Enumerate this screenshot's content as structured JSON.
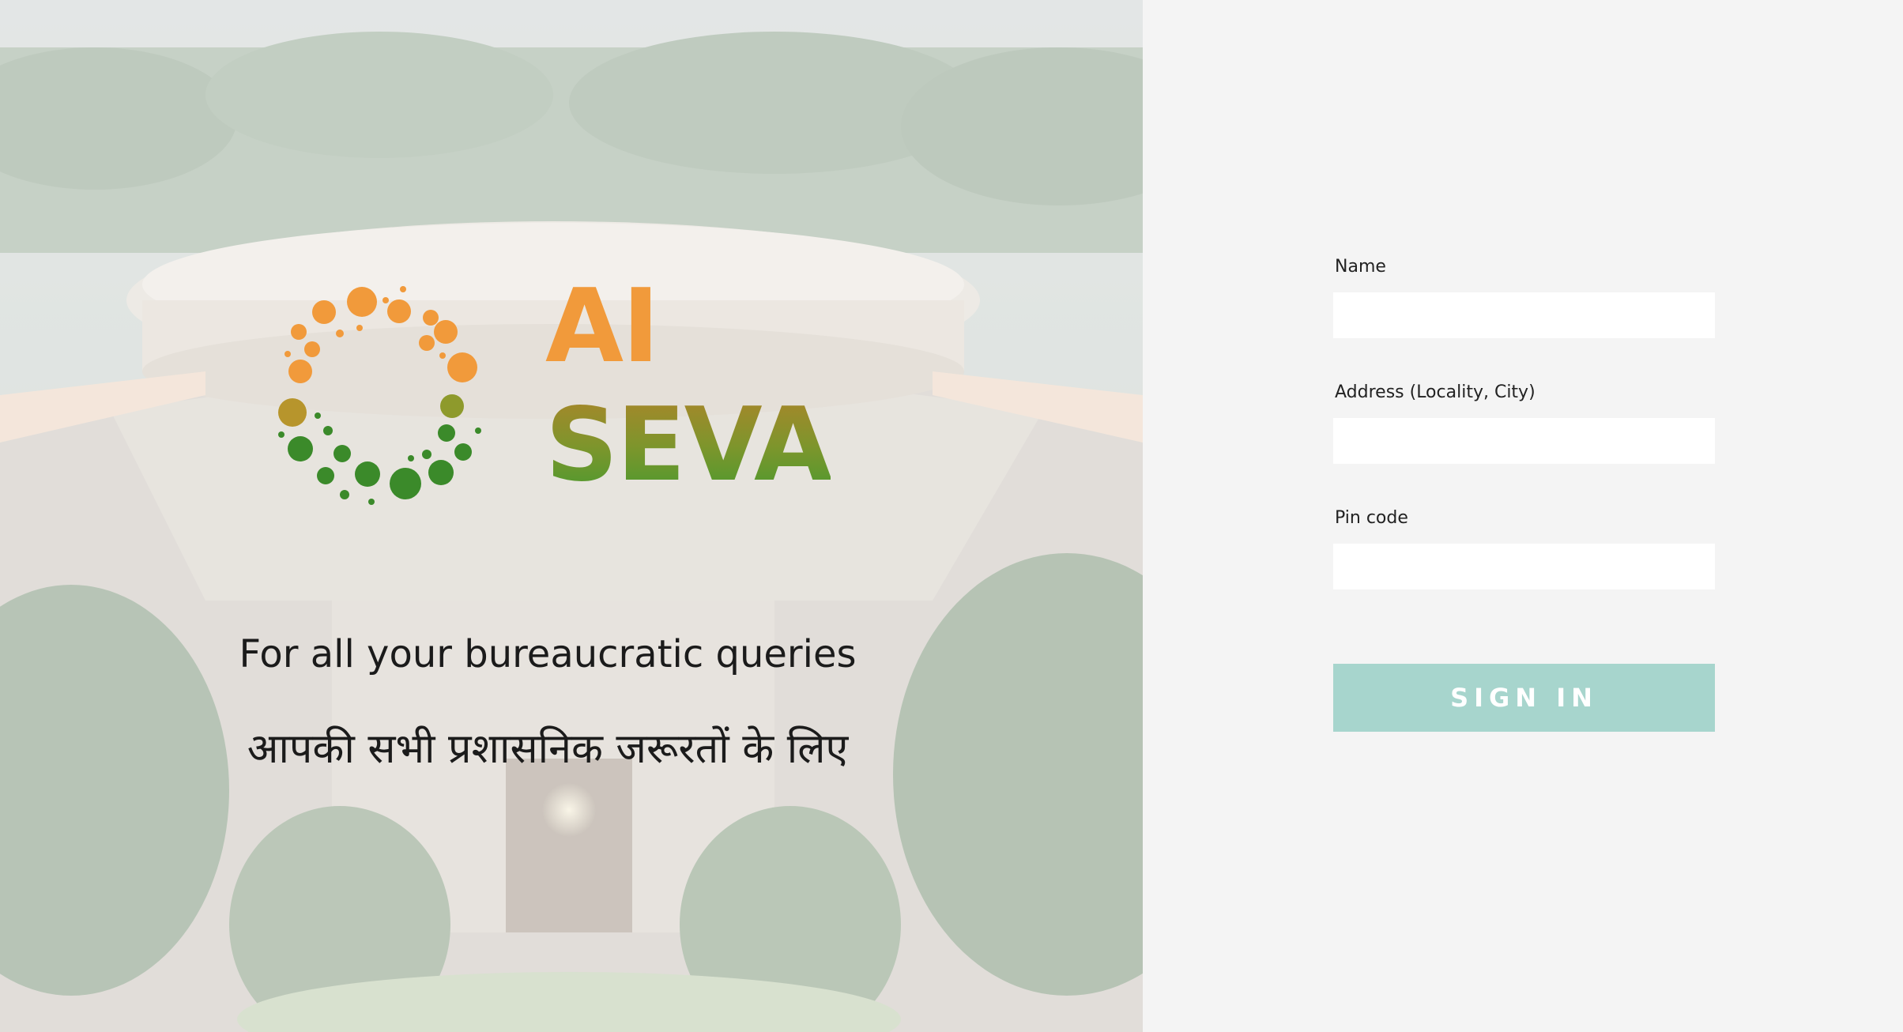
{
  "hero": {
    "logo": {
      "line1": "AI",
      "line2": "SEVA"
    },
    "tagline_en": "For all your bureaucratic queries",
    "tagline_hi": "आपकी सभी प्रशासनिक जरूरतों के लिए"
  },
  "form": {
    "fields": [
      {
        "label": "Name",
        "value": "",
        "placeholder": ""
      },
      {
        "label": "Address (Locality, City)",
        "value": "",
        "placeholder": ""
      },
      {
        "label": "Pin code",
        "value": "",
        "placeholder": ""
      }
    ],
    "submit_label": "SIGN IN"
  },
  "colors": {
    "logo_orange": "#f19a3b",
    "logo_green": "#3b8a2a",
    "submit_bg": "#a7d5cd",
    "panel_bg": "#f4f4f4"
  }
}
